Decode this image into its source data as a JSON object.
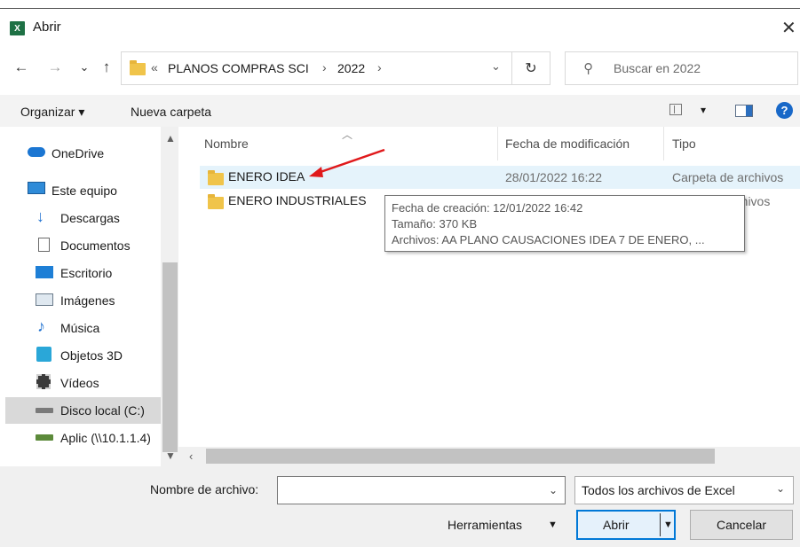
{
  "window": {
    "title": "Abrir",
    "app_icon": "excel-icon",
    "app_icon_letter": "X"
  },
  "nav": {
    "back": "←",
    "forward": "→",
    "recent": "⌄",
    "up": "↑",
    "breadcrumb_overflow": "«",
    "breadcrumb": [
      "PLANOS COMPRAS SCI",
      "2022"
    ],
    "separator": "›",
    "refresh": "↻",
    "dropdown": "⌄",
    "search_placeholder": "Buscar en 2022"
  },
  "toolbar": {
    "organize": "Organizar ▾",
    "new_folder": "Nueva carpeta",
    "view_caret": "▾",
    "help": "?"
  },
  "sidebar": {
    "items": [
      {
        "label": "OneDrive",
        "icon": "cloud-icon"
      },
      {
        "label": "Este equipo",
        "icon": "computer-icon"
      },
      {
        "label": "Descargas",
        "icon": "download-icon"
      },
      {
        "label": "Documentos",
        "icon": "document-icon"
      },
      {
        "label": "Escritorio",
        "icon": "desktop-icon"
      },
      {
        "label": "Imágenes",
        "icon": "images-icon"
      },
      {
        "label": "Música",
        "icon": "music-icon"
      },
      {
        "label": "Objetos 3D",
        "icon": "objects-3d-icon"
      },
      {
        "label": "Vídeos",
        "icon": "video-icon"
      },
      {
        "label": "Disco local (C:)",
        "icon": "drive-icon"
      },
      {
        "label": "Aplic (\\\\10.1.1.4)",
        "icon": "network-drive-icon"
      }
    ],
    "selected_index": 9
  },
  "columns": {
    "name": "Nombre",
    "modified": "Fecha de modificación",
    "type": "Tipo"
  },
  "files": [
    {
      "name": "ENERO IDEA",
      "modified": "28/01/2022 16:22",
      "type": "Carpeta de archivos"
    },
    {
      "name": "ENERO INDUSTRIALES",
      "modified": "",
      "type": "rchivos"
    }
  ],
  "tooltip": {
    "created": "Fecha de creación: 12/01/2022 16:42",
    "size": "Tamaño: 370 KB",
    "files": "Archivos: AA PLANO CAUSACIONES IDEA 7 DE ENERO, ..."
  },
  "annotation": {
    "arrow_color": "#e0191b"
  },
  "footer": {
    "filename_label": "Nombre de archivo:",
    "filename_value": "",
    "filter_value": "Todos los archivos de Excel",
    "tools": "Herramientas",
    "open": "Abrir",
    "cancel": "Cancelar"
  },
  "colors": {
    "accent": "#0078d7",
    "hover_row": "#e5f3fb",
    "excel_green": "#1e7145"
  }
}
